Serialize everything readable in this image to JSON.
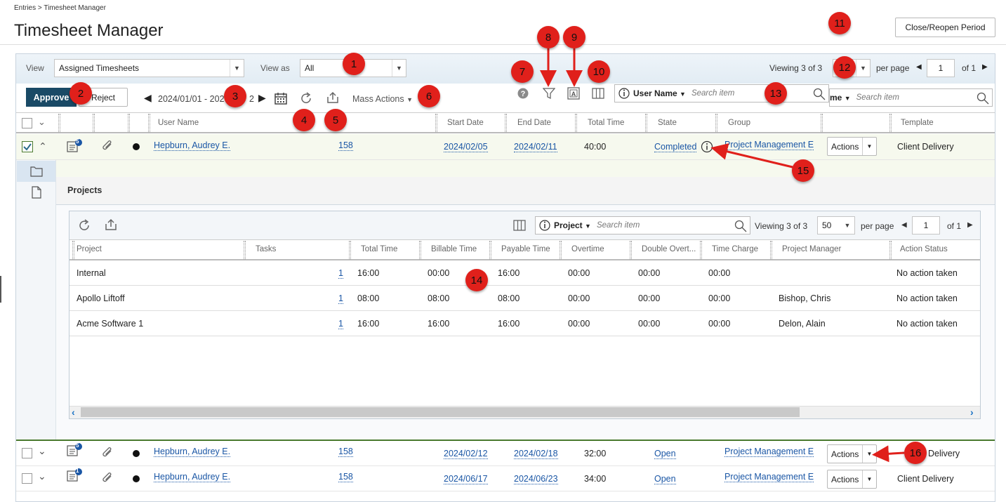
{
  "breadcrumb": "Entries > Timesheet Manager",
  "title": "Timesheet Manager",
  "close_reopen_label": "Close/Reopen Period",
  "toolbar": {
    "view_label": "View",
    "view_value": "Assigned Timesheets",
    "view_as_label": "View as",
    "view_as_value": "All",
    "viewing_prefix": "Viewing",
    "viewing_count": "3 of 3",
    "per_page_label": "per page",
    "page_value": "1",
    "of_pages": "of 1",
    "approve_label": "Approve",
    "reject_label": "Reject",
    "date_range_a": "2024/01/01 - 202",
    "date_range_b": "2",
    "mass_actions_label": "Mass Actions",
    "search_field": "User Name",
    "search_placeholder": "Search item",
    "search2_field": "me",
    "search2_placeholder": "Search item"
  },
  "columns": {
    "user_name": "User Name",
    "start_date": "Start Date",
    "end_date": "End Date",
    "total_time": "Total Time",
    "state": "State",
    "group": "Group",
    "template": "Template"
  },
  "rows": [
    {
      "badge": "5",
      "user": "Hepburn, Audrey E.",
      "num": "158",
      "start": "2024/02/05",
      "end": "2024/02/11",
      "total": "40:00",
      "state": "Completed",
      "group": "Project Management E",
      "actions": "Actions",
      "template": "Client Delivery"
    },
    {
      "badge": "5",
      "user": "Hepburn, Audrey E.",
      "num": "158",
      "start": "2024/02/12",
      "end": "2024/02/18",
      "total": "32:00",
      "state": "Open",
      "group": "Project Management E",
      "actions": "Actions",
      "template": "Delivery"
    },
    {
      "badge": "1",
      "user": "Hepburn, Audrey E.",
      "num": "158",
      "start": "2024/06/17",
      "end": "2024/06/23",
      "total": "34:00",
      "state": "Open",
      "group": "Project Management E",
      "actions": "Actions",
      "template": "Client Delivery"
    }
  ],
  "projects": {
    "section_title": "Projects",
    "search_field": "Project",
    "search_placeholder": "Search item",
    "viewing_prefix": "Viewing",
    "viewing_count": "3 of 3",
    "per_page_value": "50",
    "per_page_label": "per page",
    "page_value": "1",
    "of_pages": "of 1",
    "columns": [
      "Project",
      "Tasks",
      "Total Time",
      "Billable Time",
      "Payable Time",
      "Overtime",
      "Double Overt...",
      "Time Charge",
      "Project Manager",
      "Action Status"
    ],
    "rows": [
      [
        "Internal",
        "1",
        "16:00",
        "00:00",
        "16:00",
        "00:00",
        "00:00",
        "00:00",
        "",
        "No action taken"
      ],
      [
        "Apollo Liftoff",
        "1",
        "08:00",
        "08:00",
        "08:00",
        "00:00",
        "00:00",
        "00:00",
        "Bishop, Chris",
        "No action taken"
      ],
      [
        "Acme Software 1",
        "1",
        "16:00",
        "16:00",
        "16:00",
        "00:00",
        "00:00",
        "00:00",
        "Delon, Alain",
        "No action taken"
      ]
    ]
  },
  "callouts": [
    "1",
    "2",
    "3",
    "4",
    "5",
    "6",
    "7",
    "8",
    "9",
    "10",
    "11",
    "12",
    "13",
    "14",
    "15",
    "16"
  ],
  "colors": {
    "accent": "#1a4a66",
    "callout": "#e0201b",
    "link": "#1a56a5",
    "expanded_row": "#f6f9ee"
  }
}
